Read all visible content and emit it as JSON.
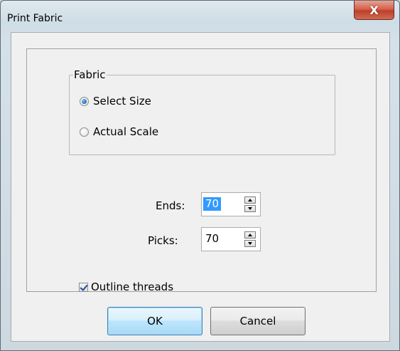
{
  "window": {
    "title": "Print Fabric",
    "close_glyph": "X"
  },
  "fabric_group": {
    "legend": "Fabric",
    "options": [
      {
        "label": "Select Size",
        "checked": true
      },
      {
        "label": "Actual Scale",
        "checked": false
      }
    ]
  },
  "ends": {
    "label": "Ends:",
    "value": "70"
  },
  "picks": {
    "label": "Picks:",
    "value": "70"
  },
  "outline": {
    "label": "Outline threads",
    "checked": true
  },
  "buttons": {
    "ok": "OK",
    "cancel": "Cancel"
  },
  "colors": {
    "selection": "#3399ff",
    "close_button": "#c0402a",
    "default_button_border": "#3c7fb1"
  }
}
